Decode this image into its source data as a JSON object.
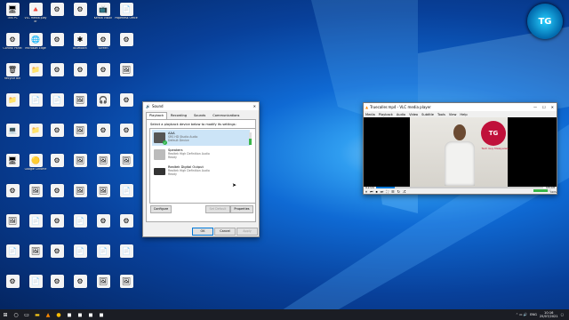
{
  "desktop": {
    "icons": [
      {
        "label": "This PC",
        "glyph": "🖥"
      },
      {
        "label": "VLC media player",
        "glyph": "🔺"
      },
      {
        "label": "",
        "glyph": "⚙"
      },
      {
        "label": "",
        "glyph": "⚙"
      },
      {
        "label": "Kerala Vision",
        "glyph": "📺"
      },
      {
        "label": "Paperless Office",
        "glyph": "📄"
      },
      {
        "label": "Control Panel",
        "glyph": "⚙"
      },
      {
        "label": "Microsoft Edge",
        "glyph": "🌐"
      },
      {
        "label": "",
        "glyph": "⚙"
      },
      {
        "label": "Bluetooth",
        "glyph": "✱"
      },
      {
        "label": "Screen",
        "glyph": "⚙"
      },
      {
        "label": "",
        "glyph": "⚙"
      },
      {
        "label": "Recycle Bin",
        "glyph": "🗑"
      },
      {
        "label": "",
        "glyph": "📁"
      },
      {
        "label": "",
        "glyph": "⚙"
      },
      {
        "label": "",
        "glyph": "⚙"
      },
      {
        "label": "",
        "glyph": "⚙"
      },
      {
        "label": "",
        "glyph": "🖼"
      },
      {
        "label": "",
        "glyph": "📁"
      },
      {
        "label": "",
        "glyph": "📄"
      },
      {
        "label": "",
        "glyph": "📄"
      },
      {
        "label": "",
        "glyph": "🖼"
      },
      {
        "label": "",
        "glyph": "🎧"
      },
      {
        "label": "",
        "glyph": "⚙"
      },
      {
        "label": "",
        "glyph": "💻"
      },
      {
        "label": "",
        "glyph": "📁"
      },
      {
        "label": "",
        "glyph": "⚙"
      },
      {
        "label": "",
        "glyph": "🖼"
      },
      {
        "label": "",
        "glyph": "⚙"
      },
      {
        "label": "",
        "glyph": "⚙"
      },
      {
        "label": "",
        "glyph": "🖥"
      },
      {
        "label": "Google Chrome",
        "glyph": "🟡"
      },
      {
        "label": "",
        "glyph": "⚙"
      },
      {
        "label": "",
        "glyph": "🖼"
      },
      {
        "label": "",
        "glyph": "🖼"
      },
      {
        "label": "",
        "glyph": "🖼"
      },
      {
        "label": "",
        "glyph": "⚙"
      },
      {
        "label": "",
        "glyph": "🖼"
      },
      {
        "label": "",
        "glyph": "⚙"
      },
      {
        "label": "",
        "glyph": "🖼"
      },
      {
        "label": "",
        "glyph": "🖼"
      },
      {
        "label": "",
        "glyph": "📄"
      },
      {
        "label": "",
        "glyph": "🖼"
      },
      {
        "label": "",
        "glyph": "📄"
      },
      {
        "label": "",
        "glyph": "⚙"
      },
      {
        "label": "",
        "glyph": "📄"
      },
      {
        "label": "",
        "glyph": "⚙"
      },
      {
        "label": "",
        "glyph": "⚙"
      },
      {
        "label": "",
        "glyph": "📄"
      },
      {
        "label": "",
        "glyph": "🖼"
      },
      {
        "label": "",
        "glyph": "⚙"
      },
      {
        "label": "",
        "glyph": "📄"
      },
      {
        "label": "",
        "glyph": "📄"
      },
      {
        "label": "",
        "glyph": "📄"
      },
      {
        "label": "",
        "glyph": "⚙"
      },
      {
        "label": "",
        "glyph": "📄"
      },
      {
        "label": "",
        "glyph": "⚙"
      },
      {
        "label": "",
        "glyph": "⚙"
      },
      {
        "label": "",
        "glyph": "🖼"
      },
      {
        "label": "",
        "glyph": "🖼"
      }
    ]
  },
  "sound_dialog": {
    "title": "Sound",
    "tabs": [
      "Playback",
      "Recording",
      "Sounds",
      "Communications"
    ],
    "instruction": "Select a playback device below to modify its settings:",
    "devices": [
      {
        "name": "AAA",
        "desc": "SRS HD Studio Audio",
        "status": "Default Device"
      },
      {
        "name": "Speakers",
        "desc": "Realtek High Definition Audio",
        "status": "Ready"
      },
      {
        "name": "Realtek Digital Output",
        "desc": "Realtek High Definition Audio",
        "status": "Ready"
      }
    ],
    "buttons": {
      "configure": "Configure",
      "set_default": "Set Default",
      "properties": "Properties",
      "ok": "OK",
      "cancel": "Cancel",
      "apply": "Apply"
    }
  },
  "vlc": {
    "title": "Truecaller.mp4 - VLC media player",
    "menu": [
      "Media",
      "Playback",
      "Audio",
      "Video",
      "Subtitle",
      "Tools",
      "View",
      "Help"
    ],
    "time_elapsed": "01:03",
    "time_total": "09:59",
    "progress": 0.11,
    "video_logo_text": "Tech Guy Malayalam",
    "volume": "100%"
  },
  "taskbar": {
    "time": "10:16",
    "date": "25/07/2021",
    "lang": "ENG"
  },
  "colors": {
    "accent": "#0078d7",
    "taskbar": "#1b1d24",
    "vlc_orange": "#ff8800"
  }
}
